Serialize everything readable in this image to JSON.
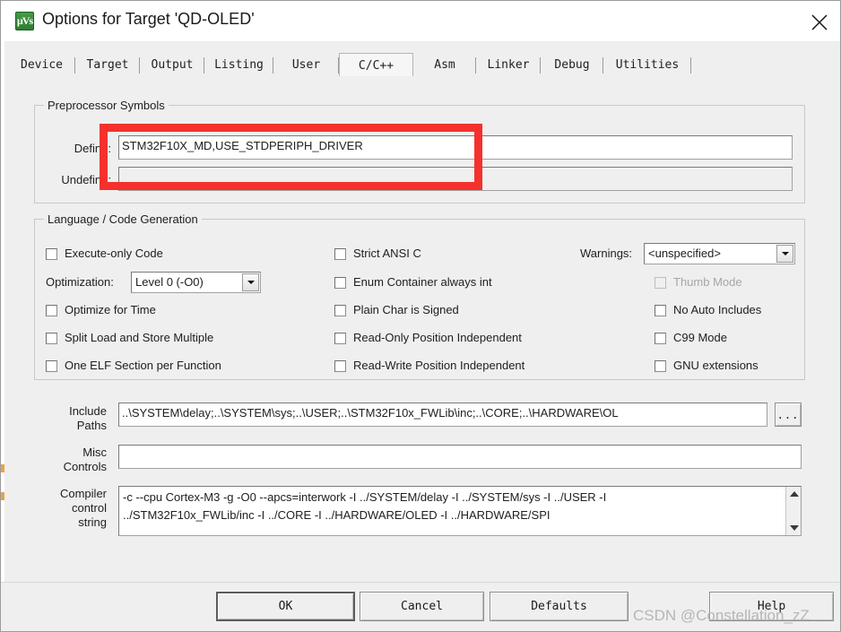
{
  "window": {
    "title": "Options for Target 'QD-OLED'",
    "icon": "keil-uvision-icon",
    "close_label": "close-icon"
  },
  "tabs": [
    {
      "label": "Device",
      "active": false
    },
    {
      "label": "Target",
      "active": false
    },
    {
      "label": "Output",
      "active": false
    },
    {
      "label": "Listing",
      "active": false
    },
    {
      "label": "User",
      "active": false
    },
    {
      "label": "C/C++",
      "active": true
    },
    {
      "label": "Asm",
      "active": false
    },
    {
      "label": "Linker",
      "active": false
    },
    {
      "label": "Debug",
      "active": false
    },
    {
      "label": "Utilities",
      "active": false
    }
  ],
  "preprocessor": {
    "legend": "Preprocessor Symbols",
    "define_label": "Define:",
    "define_value": "STM32F10X_MD,USE_STDPERIPH_DRIVER",
    "undefine_label": "Undefine:",
    "undefine_value": ""
  },
  "language": {
    "legend": "Language / Code Generation",
    "col1": [
      {
        "label": "Execute-only Code",
        "checked": false,
        "disabled": false
      },
      {
        "label": "Optimize for Time",
        "checked": false,
        "disabled": false
      },
      {
        "label": "Split Load and Store Multiple",
        "checked": false,
        "disabled": false
      },
      {
        "label": "One ELF Section per Function",
        "checked": false,
        "disabled": false
      }
    ],
    "optimization_label": "Optimization:",
    "optimization_value": "Level 0 (-O0)",
    "col2": [
      {
        "label": "Strict ANSI C",
        "checked": false,
        "disabled": false
      },
      {
        "label": "Enum Container always int",
        "checked": false,
        "disabled": false
      },
      {
        "label": "Plain Char is Signed",
        "checked": false,
        "disabled": false
      },
      {
        "label": "Read-Only Position Independent",
        "checked": false,
        "disabled": false
      },
      {
        "label": "Read-Write Position Independent",
        "checked": false,
        "disabled": false
      }
    ],
    "warnings_label": "Warnings:",
    "warnings_value": "<unspecified>",
    "col3": [
      {
        "label": "Thumb Mode",
        "checked": false,
        "disabled": true
      },
      {
        "label": "No Auto Includes",
        "checked": false,
        "disabled": false
      },
      {
        "label": "C99 Mode",
        "checked": false,
        "disabled": false
      },
      {
        "label": "GNU extensions",
        "checked": false,
        "disabled": false
      }
    ]
  },
  "paths": {
    "include_label_line1": "Include",
    "include_label_line2": "Paths",
    "include_value": "..\\SYSTEM\\delay;..\\SYSTEM\\sys;..\\USER;..\\STM32F10x_FWLib\\inc;..\\CORE;..\\HARDWARE\\OL",
    "browse_label": "...",
    "misc_label_line1": "Misc",
    "misc_label_line2": "Controls",
    "misc_value": ""
  },
  "compiler": {
    "label_line1": "Compiler",
    "label_line2": "control",
    "label_line3": "string",
    "line1": "-c --cpu Cortex-M3 -g -O0 --apcs=interwork -I ../SYSTEM/delay -I ../SYSTEM/sys -I ../USER -I",
    "line2": "../STM32F10x_FWLib/inc -I ../CORE -I ../HARDWARE/OLED -I ../HARDWARE/SPI"
  },
  "buttons": {
    "ok": "OK",
    "cancel": "Cancel",
    "defaults": "Defaults",
    "help": "Help"
  },
  "watermark": "CSDN @Constellation_zZ",
  "colors": {
    "annotation": "#f4312c",
    "dialog_bg": "#efefef",
    "titlebar_bg": "#ffffff",
    "field_bg": "#ffffff"
  }
}
